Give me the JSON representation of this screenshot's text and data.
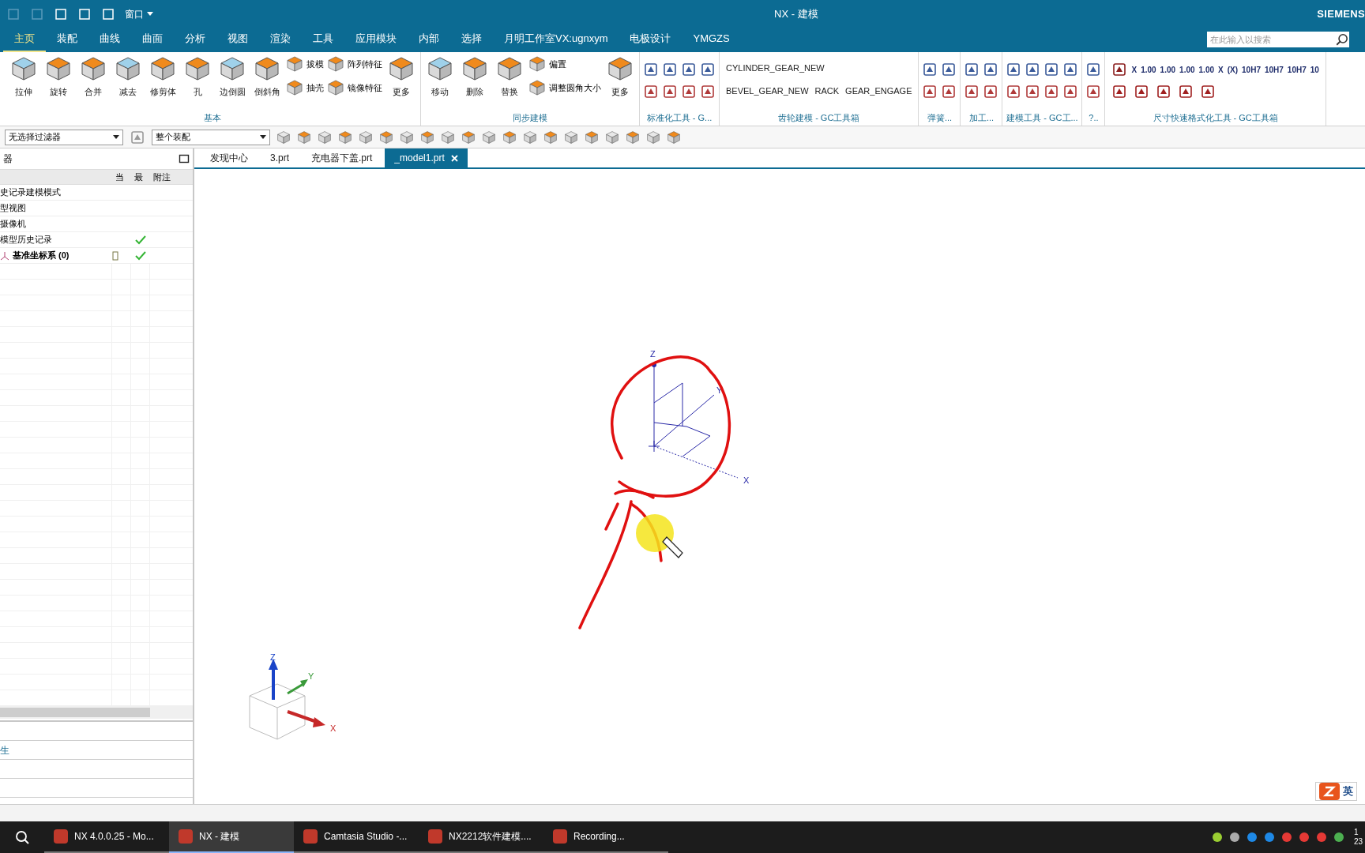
{
  "window": {
    "title": "NX - 建模",
    "brand": "SIEMENS",
    "window_menu": "窗口"
  },
  "menu_tabs": [
    {
      "label": "主页",
      "selected": true
    },
    {
      "label": "装配",
      "selected": false
    },
    {
      "label": "曲线",
      "selected": false
    },
    {
      "label": "曲面",
      "selected": false
    },
    {
      "label": "分析",
      "selected": false
    },
    {
      "label": "视图",
      "selected": false
    },
    {
      "label": "渲染",
      "selected": false
    },
    {
      "label": "工具",
      "selected": false
    },
    {
      "label": "应用模块",
      "selected": false
    },
    {
      "label": "内部",
      "selected": false
    },
    {
      "label": "选择",
      "selected": false
    },
    {
      "label": "月明工作室VX:ugnxym",
      "selected": false
    },
    {
      "label": "电极设计",
      "selected": false
    },
    {
      "label": "YMGZS",
      "selected": false
    }
  ],
  "search": {
    "placeholder": "在此输入以搜索"
  },
  "ribbon": [
    {
      "kind": "features",
      "title": "基本",
      "large": [
        "拉伸",
        "旋转",
        "合并",
        "减去",
        "修剪体",
        "孔",
        "边倒圆",
        "倒斜角"
      ],
      "small": [
        "拔模",
        "抽壳",
        "阵列特征",
        "镜像特征"
      ],
      "more": "更多"
    },
    {
      "kind": "features",
      "title": "同步建模",
      "large": [
        "移动",
        "删除",
        "替换"
      ],
      "small": [
        "偏置",
        "调整圆角大小"
      ],
      "more": "更多"
    },
    {
      "kind": "icons",
      "title": "标准化工具 - G..."
    },
    {
      "kind": "text",
      "title": "齿轮建模 - GC工具箱",
      "items": [
        "CYLINDER_GEAR_NEW",
        "BEVEL_GEAR_NEW",
        "RACK",
        "GEAR_ENGAGE"
      ]
    },
    {
      "kind": "icons",
      "title": "弹簧..."
    },
    {
      "kind": "icons",
      "title": "加工..."
    },
    {
      "kind": "icons",
      "title": "建模工具 - GC工..."
    },
    {
      "kind": "icons",
      "title": "?.."
    },
    {
      "kind": "format",
      "title": "尺寸快速格式化工具 - GC工具箱",
      "items": [
        "X",
        "1.00",
        "1.00",
        "1.00",
        "1.00",
        "X",
        "(X)",
        "10H7",
        "10H7",
        "10H7",
        "10"
      ]
    }
  ],
  "filters": [
    {
      "value": "无选择过滤器"
    },
    {
      "value": "整个装配"
    }
  ],
  "doc_tabs": [
    {
      "label": "发现中心",
      "selected": false
    },
    {
      "label": "3.prt",
      "selected": false
    },
    {
      "label": "充电器下盖.prt",
      "selected": false
    },
    {
      "label": "_model1.prt",
      "selected": true
    }
  ],
  "navigator": {
    "title": "器",
    "columns": [
      "当",
      "最",
      "附注"
    ],
    "rows": [
      {
        "name": "史记录建模模式",
        "latest": false
      },
      {
        "name": "型视图",
        "latest": false
      },
      {
        "name": "摄像机",
        "latest": false
      },
      {
        "name": "模型历史记录",
        "latest": true
      },
      {
        "name": "基准坐标系 (0)",
        "latest": true
      }
    ],
    "lower_label": "生"
  },
  "canvas": {
    "datum_axes": [
      "Z",
      "Y",
      "X"
    ],
    "triad_axes": [
      "Z",
      "Y",
      "X"
    ]
  },
  "taskbar": [
    {
      "label": "NX 4.0.0.25 - Mo...",
      "selected": false
    },
    {
      "label": "NX - 建模",
      "selected": true
    },
    {
      "label": "Camtasia Studio -...",
      "selected": false
    },
    {
      "label": "NX2212软件建模....",
      "selected": false
    },
    {
      "label": "Recording...",
      "selected": false
    }
  ],
  "ime": "英",
  "clock": [
    "1",
    "23"
  ]
}
